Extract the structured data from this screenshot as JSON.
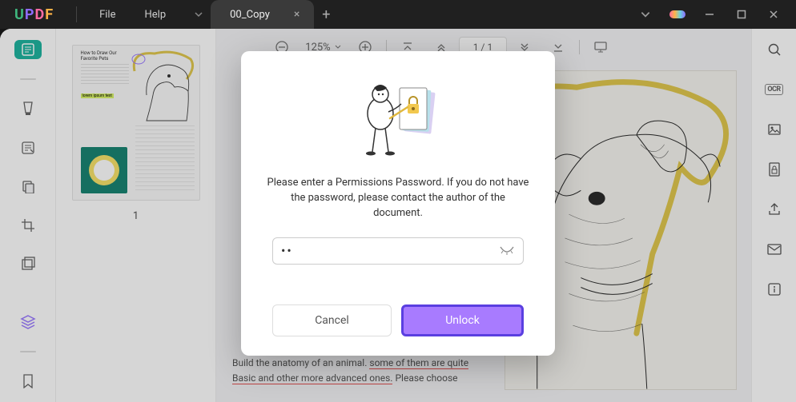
{
  "app": {
    "name_letters": [
      "U",
      "P",
      "D",
      "F"
    ]
  },
  "menu": {
    "file": "File",
    "help": "Help"
  },
  "tabs": {
    "active": {
      "title": "00_Copy"
    },
    "add_tooltip": "New tab"
  },
  "window_controls": {
    "minimize": "–",
    "maximize": "□",
    "close": "✕",
    "down_chevron": "⌄"
  },
  "left_tools": {
    "reader": "reader-icon",
    "highlighter": "highlighter-icon",
    "annotations": "annotations-icon",
    "clipboard": "clipboard-icon",
    "crop": "crop-icon",
    "pages": "pages-icon",
    "layers": "layers-icon",
    "bookmark": "bookmark-icon"
  },
  "thumb": {
    "page_number": "1",
    "title_line1": "How to Draw Our",
    "title_line2": "Favorite Pets",
    "highlight_sample": "lorem ipsum text"
  },
  "doc_toolbar": {
    "zoom_label": "125%",
    "page_indicator": "1 / 1"
  },
  "right_tools": {
    "search": "search-icon",
    "ocr_label": "OCR",
    "image": "image-icon",
    "secure": "secure-icon",
    "share": "share-icon",
    "mail": "mail-icon",
    "info": "info-icon"
  },
  "doc_text": {
    "line1_a": "Build the anatomy of an animal. ",
    "line1_b": "some of them are quite",
    "line2_a": "Basic and other more advanced ones.",
    "line2_b": " Please choose"
  },
  "modal": {
    "message": "Please enter a Permissions Password. If you do not have the password, please contact the author of the document.",
    "password_mask": "••",
    "cancel": "Cancel",
    "unlock": "Unlock"
  }
}
